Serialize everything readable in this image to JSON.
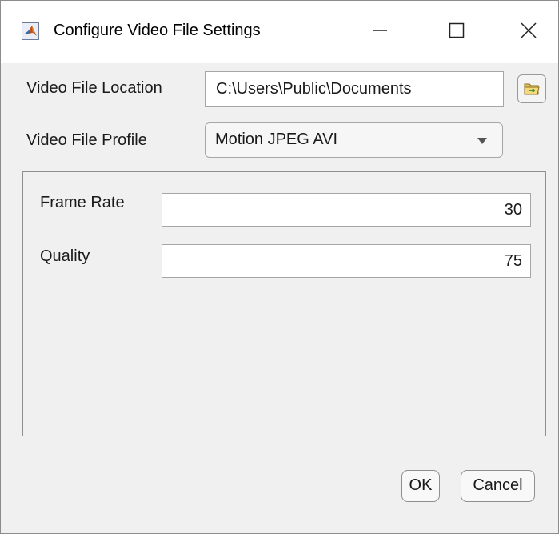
{
  "window": {
    "title": "Configure Video File Settings",
    "app_icon": "matlab-icon",
    "controls": [
      "minimize-icon",
      "maximize-icon",
      "close-icon"
    ]
  },
  "location": {
    "label": "Video File Location",
    "value": "C:\\Users\\Public\\Documents",
    "browse_icon": "folder-browse-icon"
  },
  "profile": {
    "label": "Video File Profile",
    "selected": "Motion JPEG AVI",
    "arrow_icon": "dropdown-arrow-icon"
  },
  "settings": {
    "frame_rate_label": "Frame Rate",
    "frame_rate_value": "30",
    "quality_label": "Quality",
    "quality_value": "75"
  },
  "buttons": {
    "ok": "OK",
    "cancel": "Cancel"
  },
  "colors": {
    "window_background": "#f0f0f0",
    "titlebar_background": "#ffffff",
    "border": "#8f8f8f"
  }
}
